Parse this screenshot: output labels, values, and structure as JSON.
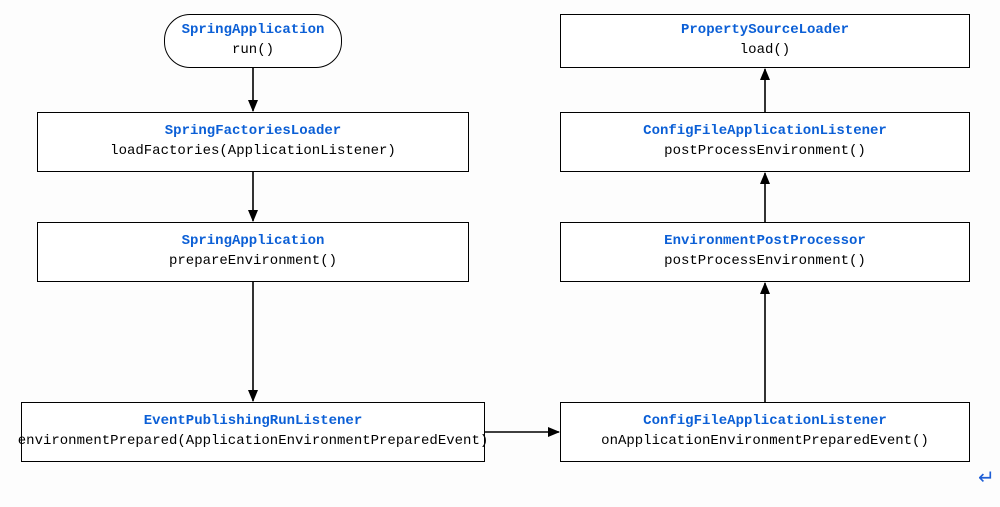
{
  "colors": {
    "title": "#0b5fd6",
    "border": "#000000",
    "background": "#ffffff"
  },
  "nodes": {
    "n1": {
      "title": "SpringApplication",
      "method": "run()"
    },
    "n2": {
      "title": "SpringFactoriesLoader",
      "method": "loadFactories(ApplicationListener)"
    },
    "n3": {
      "title": "SpringApplication",
      "method": "prepareEnvironment()"
    },
    "n4": {
      "title": "EventPublishingRunListener",
      "method": "environmentPrepared(ApplicationEnvironmentPreparedEvent)"
    },
    "n5": {
      "title": "ConfigFileApplicationListener",
      "method": "onApplicationEnvironmentPreparedEvent()"
    },
    "n6": {
      "title": "EnvironmentPostProcessor",
      "method": "postProcessEnvironment()"
    },
    "n7": {
      "title": "ConfigFileApplicationListener",
      "method": "postProcessEnvironment()"
    },
    "n8": {
      "title": "PropertySourceLoader",
      "method": "load()"
    }
  },
  "flow_edges": [
    [
      "n1",
      "n2"
    ],
    [
      "n2",
      "n3"
    ],
    [
      "n3",
      "n4"
    ],
    [
      "n4",
      "n5"
    ],
    [
      "n5",
      "n6"
    ],
    [
      "n6",
      "n7"
    ],
    [
      "n7",
      "n8"
    ]
  ],
  "return_marker": "↵"
}
